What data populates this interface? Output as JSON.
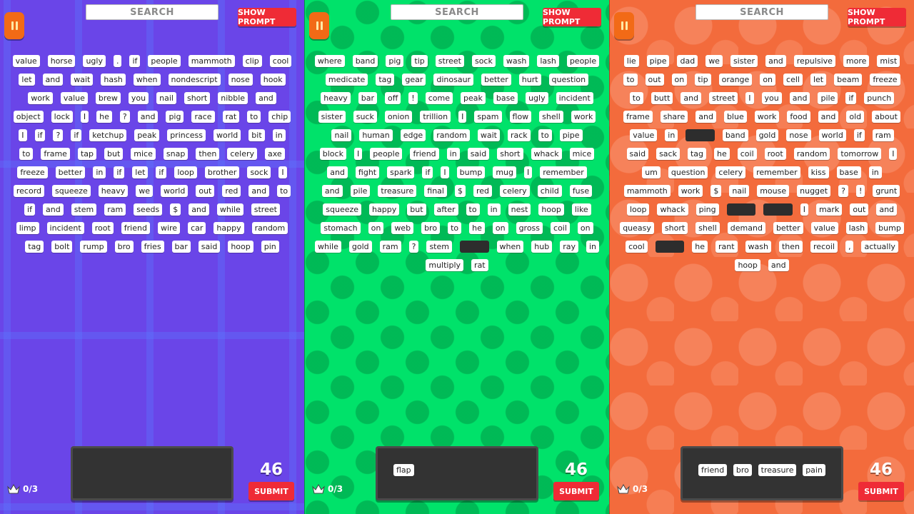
{
  "panels": [
    {
      "search_label": "SEARCH",
      "prompt_label": "SHOW PROMPT",
      "rows": [
        [
          "value",
          "horse",
          "ugly",
          ".",
          "if",
          "people",
          "mammoth",
          "clip",
          "cool"
        ],
        [
          "let",
          "and",
          "wait",
          "hash",
          "when",
          "nondescript",
          "nose",
          "hook"
        ],
        [
          "work",
          "value",
          "brew",
          "you",
          "nail",
          "short",
          "nibble",
          "and"
        ],
        [
          "object",
          "lock",
          "I",
          "he",
          "?",
          "and",
          "pig",
          "race",
          "rat",
          "to",
          "chip"
        ],
        [
          "I",
          "if",
          "?",
          "if",
          "ketchup",
          "peak",
          "princess",
          "world",
          "bit",
          "in"
        ],
        [
          "to",
          "frame",
          "tap",
          "but",
          "mice",
          "snap",
          "then",
          "celery",
          "axe"
        ],
        [
          "freeze",
          "better",
          "in",
          "if",
          "let",
          "if",
          "loop",
          "brother",
          "sock",
          "I"
        ],
        [
          "record",
          "squeeze",
          "heavy",
          "we",
          "world",
          "out",
          "red",
          "and",
          "to"
        ],
        [
          "if",
          "and",
          "stem",
          "ram",
          "seeds",
          "$",
          "and",
          "while",
          "street"
        ],
        [
          "limp",
          "incident",
          "root",
          "friend",
          "wire",
          "car",
          "happy",
          "random"
        ],
        [
          "tag",
          "bolt",
          "rump",
          "bro",
          "fries",
          "bar",
          "said",
          "hoop",
          "pin"
        ]
      ],
      "answer_words": [],
      "timer": "46",
      "submit_label": "SUBMIT",
      "score": "0/3"
    },
    {
      "search_label": "SEARCH",
      "prompt_label": "SHOW PROMPT",
      "rows": [
        [
          "where",
          "band",
          "pig",
          "tip",
          "street",
          "sock",
          "wash",
          "lash",
          "people"
        ],
        [
          "medicate",
          "tag",
          "gear",
          "dinosaur",
          "better",
          "hurt",
          "question"
        ],
        [
          "heavy",
          "bar",
          "off",
          "!",
          "come",
          "peak",
          "base",
          "ugly",
          "incident"
        ],
        [
          "sister",
          "suck",
          "onion",
          "trillion",
          "I",
          "spam",
          "flow",
          "shell",
          "work"
        ],
        [
          "nail",
          "human",
          "edge",
          "random",
          "wait",
          "rack",
          "to",
          "pipe"
        ],
        [
          "block",
          "I",
          "people",
          "friend",
          "in",
          "said",
          "short",
          "whack",
          "mice"
        ],
        [
          "and",
          "fight",
          "spark",
          "if",
          "I",
          "bump",
          "mug",
          "I",
          "remember"
        ],
        [
          "and",
          "pile",
          "treasure",
          "final",
          "$",
          "red",
          "celery",
          "child",
          "fuse"
        ],
        [
          "squeeze",
          "happy",
          "but",
          "after",
          "to",
          "in",
          "nest",
          "hoop",
          "like"
        ],
        [
          "stomach",
          "on",
          "web",
          "bro",
          "to",
          "he",
          "on",
          "gross",
          "coil",
          "on"
        ],
        [
          "while",
          "gold",
          "ram",
          "?",
          "stem",
          "__GAP__",
          "when",
          "hub",
          "ray",
          "in"
        ],
        [
          "multiply",
          "rat"
        ]
      ],
      "answer_words": [
        "flap"
      ],
      "timer": "46",
      "submit_label": "SUBMIT",
      "score": "0/3"
    },
    {
      "search_label": "SEARCH",
      "prompt_label": "SHOW PROMPT",
      "rows": [
        [
          "lie",
          "pipe",
          "dad",
          "we",
          "sister",
          "and",
          "repulsive",
          "more",
          "mist"
        ],
        [
          "to",
          "out",
          "on",
          "tip",
          "orange",
          "on",
          "cell",
          "let",
          "beam",
          "freeze"
        ],
        [
          "to",
          "butt",
          "and",
          "street",
          "I",
          "you",
          "and",
          "pile",
          "if",
          "punch"
        ],
        [
          "frame",
          "share",
          "and",
          "blue",
          "work",
          "food",
          "and",
          "old",
          "about"
        ],
        [
          "value",
          "in",
          "__GAP__",
          "band",
          "gold",
          "nose",
          "world",
          "if",
          "ram"
        ],
        [
          "said",
          "sack",
          "tag",
          "he",
          "coil",
          "root",
          "random",
          "tomorrow",
          "I"
        ],
        [
          "um",
          "question",
          "celery",
          "remember",
          "kiss",
          "base",
          "in"
        ],
        [
          "mammoth",
          "work",
          "$",
          "nail",
          "mouse",
          "nugget",
          "?",
          "!",
          "grunt"
        ],
        [
          "loop",
          "whack",
          "ping",
          "__GAP__",
          "__GAP__",
          "I",
          "mark",
          "out",
          "and"
        ],
        [
          "queasy",
          "short",
          "shell",
          "demand",
          "better",
          "value",
          "lash",
          "bump"
        ],
        [
          "cool",
          "__GAP__",
          "he",
          "rant",
          "wash",
          "then",
          "recoil",
          ",",
          "actually"
        ],
        [
          "hoop",
          "and"
        ]
      ],
      "answer_words": [
        "friend",
        "bro",
        "treasure",
        "pain"
      ],
      "timer": "46",
      "submit_label": "SUBMIT",
      "score": "0/3"
    }
  ],
  "icons": {
    "pause": "pause-icon",
    "crown": "crown-icon"
  },
  "colors": {
    "panel_1_bg": "#6a45e8",
    "panel_2_bg": "#00e26a",
    "panel_3_bg": "#f36b3c",
    "accent_red": "#ef2b36",
    "pause_orange": "#f26a16",
    "answer_box": "#333333"
  }
}
